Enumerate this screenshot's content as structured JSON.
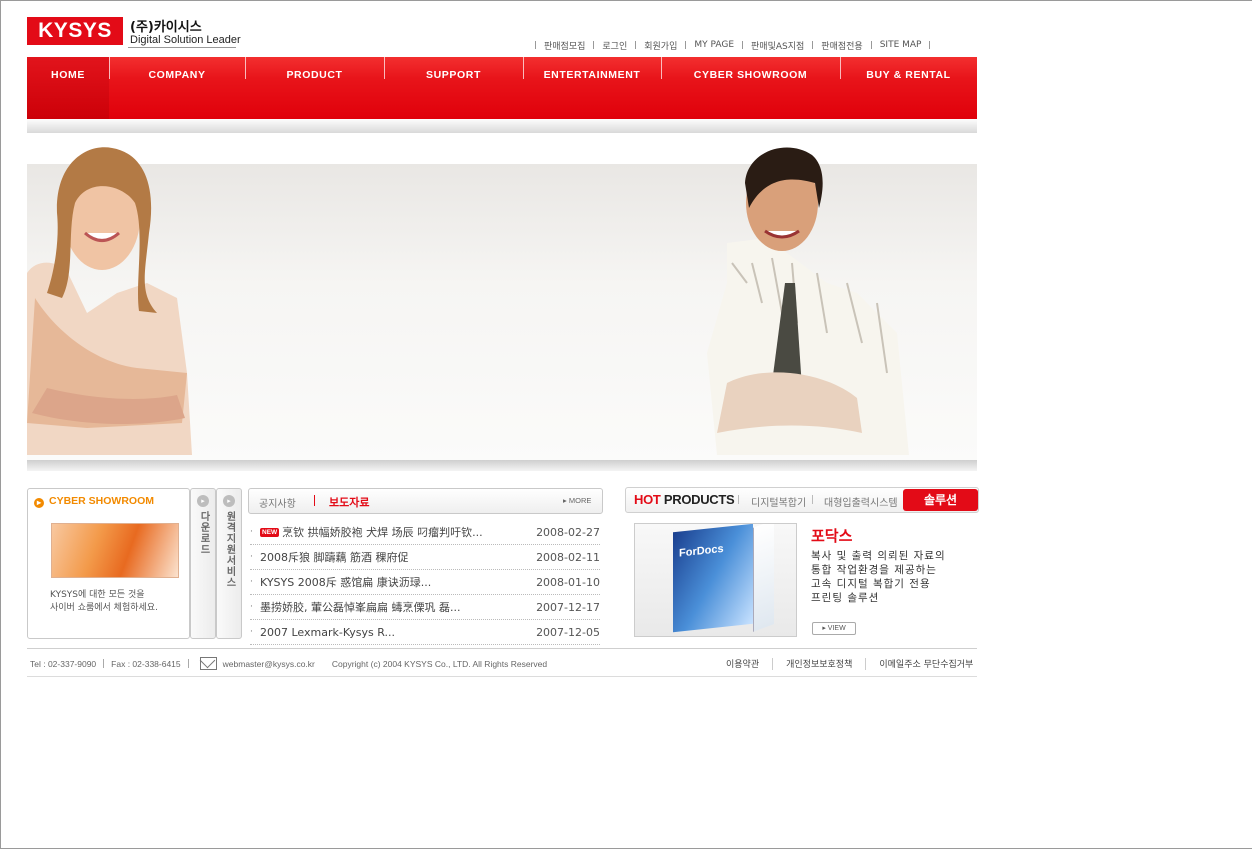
{
  "logo": {
    "brand": "KYSYS",
    "korean": "(주)카이시스",
    "tagline": "Digital Solution Leader",
    "color": "#e30b17"
  },
  "top_links": [
    "판매점모집",
    "로그인",
    "회원가입",
    "MY PAGE",
    "판매및AS지점",
    "판매점전용",
    "SITE MAP"
  ],
  "nav": [
    "HOME",
    "COMPANY",
    "PRODUCT",
    "SUPPORT",
    "ENTERTAINMENT",
    "CYBER SHOWROOM",
    "BUY & RENTAL"
  ],
  "cyber": {
    "title": "CYBER SHOWROOM",
    "text1": "KYSYS에 대한 모든 것을",
    "text2": "사이버 쇼룸에서 체험하세요."
  },
  "side_tabs": [
    "다운로드",
    "원격지원서비스"
  ],
  "news": {
    "tab_notice": "공지사항",
    "tab_press": "보도자료",
    "more": "MORE",
    "new_badge": "NEW",
    "items": [
      {
        "title": "烹钦  拱幅娇胶袍  犬焊  场辰  叼瘤判吁钦...",
        "date": "2008-02-27",
        "is_new": true
      },
      {
        "title": "2008斥狼  脚躊藕  筋酒  稞府促",
        "date": "2008-02-11",
        "is_new": false
      },
      {
        "title": "KYSYS 2008斥  惑馆扁  康诀沥琭...",
        "date": "2008-01-10",
        "is_new": false
      },
      {
        "title": "墨捞娇胶, 葷公磊悼峯扁扁  蝳烹傈巩  磊...",
        "date": "2007-12-17",
        "is_new": false
      },
      {
        "title": "2007 Lexmark-Kysys R...",
        "date": "2007-12-05",
        "is_new": false
      }
    ]
  },
  "hot_products": {
    "hot": "HOT",
    "products": "PRODUCTS",
    "tabs": [
      "디지털복합기",
      "대형입출력시스템"
    ],
    "active_tab": "솔루션",
    "product_name": "포닥스",
    "box_label": "ForDocs",
    "desc": [
      "복사 및 출력 의뢰된 자료의",
      "통합 작업환경을 제공하는",
      "고속 디지털 복합기 전용",
      "프린팅 솔루션"
    ],
    "view": "VIEW"
  },
  "footer": {
    "tel": "Tel : 02-337-9090",
    "fax": "Fax : 02-338-6415",
    "email": "webmaster@kysys.co.kr",
    "copyright": "Copyright (c) 2004 KYSYS Co., LTD.  All Rights Reserved",
    "links": [
      "이용약관",
      "개인정보보호정책",
      "이메일주소 무단수집거부"
    ]
  }
}
